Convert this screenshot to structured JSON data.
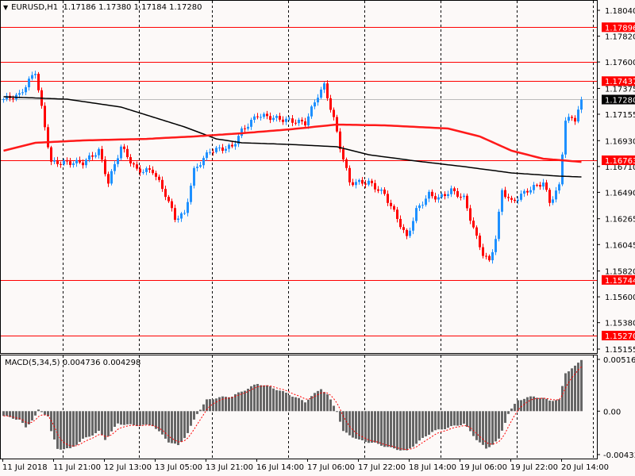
{
  "header": {
    "symbol": "EURUSD,H1",
    "ohlc": "1.17186 1.17380 1.17184 1.17280"
  },
  "macd": {
    "label": "MACD(5,34,5) 0.004736 0.004298"
  },
  "colors": {
    "background": "#fcf9f8",
    "bull": "#1e90ff",
    "bear": "#ff0000",
    "level_line": "#ff0000",
    "ma_slow": "#ff1a1a",
    "ma_fast": "#000000",
    "histogram": "#666666",
    "signal": "#ff0000"
  },
  "chart_data": {
    "type": "candlestick",
    "symbol": "EURUSD",
    "timeframe": "H1",
    "price_axis": {
      "range": [
        1.15155,
        1.1804
      ],
      "ticks": [
        "1.18040",
        "1.17820",
        "1.17600",
        "1.17375",
        "1.17155",
        "1.16930",
        "1.16710",
        "1.16490",
        "1.16265",
        "1.16045",
        "1.15820",
        "1.15600",
        "1.15380",
        "1.15155"
      ]
    },
    "levels": [
      {
        "price": "1.17896",
        "labeled": true
      },
      {
        "price": "1.17600",
        "labeled": false
      },
      {
        "price": "1.17437",
        "labeled": true
      },
      {
        "price": "1.16763",
        "labeled": true
      },
      {
        "price": "1.15744",
        "labeled": true
      },
      {
        "price": "1.15270",
        "labeled": true
      }
    ],
    "current_price": "1.17280",
    "time_labels": [
      "11 Jul 2018",
      "11 Jul 21:00",
      "12 Jul 13:00",
      "13 Jul 05:00",
      "13 Jul 21:00",
      "16 Jul 14:00",
      "17 Jul 06:00",
      "17 Jul 22:00",
      "18 Jul 14:00",
      "19 Jul 06:00",
      "19 Jul 22:00",
      "20 Jul 14:00"
    ],
    "bars_total": 183,
    "close_keypoints": [
      [
        0,
        1.17283
      ],
      [
        5,
        1.17317
      ],
      [
        10,
        1.1752
      ],
      [
        13,
        1.17047
      ],
      [
        15,
        1.16743
      ],
      [
        20,
        1.16743
      ],
      [
        25,
        1.16743
      ],
      [
        30,
        1.16844
      ],
      [
        33,
        1.16574
      ],
      [
        37,
        1.16878
      ],
      [
        42,
        1.16675
      ],
      [
        47,
        1.16675
      ],
      [
        51,
        1.16472
      ],
      [
        54,
        1.1627
      ],
      [
        57,
        1.16304
      ],
      [
        60,
        1.16675
      ],
      [
        65,
        1.16844
      ],
      [
        72,
        1.16878
      ],
      [
        75,
        1.17013
      ],
      [
        80,
        1.17148
      ],
      [
        87,
        1.17114
      ],
      [
        95,
        1.17081
      ],
      [
        99,
        1.17317
      ],
      [
        101,
        1.17398
      ],
      [
        104,
        1.17114
      ],
      [
        106,
        1.16878
      ],
      [
        109,
        1.16574
      ],
      [
        115,
        1.16574
      ],
      [
        120,
        1.16472
      ],
      [
        124,
        1.1627
      ],
      [
        127,
        1.16101
      ],
      [
        130,
        1.16337
      ],
      [
        134,
        1.16472
      ],
      [
        137,
        1.16439
      ],
      [
        141,
        1.16506
      ],
      [
        145,
        1.16439
      ],
      [
        149,
        1.16101
      ],
      [
        151,
        1.15966
      ],
      [
        153,
        1.15898
      ],
      [
        155,
        1.16101
      ],
      [
        157,
        1.16506
      ],
      [
        160,
        1.16405
      ],
      [
        165,
        1.16506
      ],
      [
        170,
        1.16574
      ],
      [
        172,
        1.16405
      ],
      [
        175,
        1.1654
      ],
      [
        177,
        1.17114
      ],
      [
        180,
        1.17114
      ],
      [
        182,
        1.17283
      ]
    ],
    "ma_fast_keypoints": [
      [
        0,
        1.17304
      ],
      [
        20,
        1.17283
      ],
      [
        37,
        1.17216
      ],
      [
        57,
        1.17047
      ],
      [
        67,
        1.16945
      ],
      [
        75,
        1.16912
      ],
      [
        90,
        1.16898
      ],
      [
        105,
        1.16878
      ],
      [
        115,
        1.1681
      ],
      [
        130,
        1.16756
      ],
      [
        145,
        1.16709
      ],
      [
        160,
        1.16655
      ],
      [
        175,
        1.16628
      ],
      [
        182,
        1.16621
      ]
    ],
    "ma_slow_keypoints": [
      [
        0,
        1.16844
      ],
      [
        10,
        1.16912
      ],
      [
        25,
        1.16932
      ],
      [
        45,
        1.16945
      ],
      [
        60,
        1.16966
      ],
      [
        75,
        1.16993
      ],
      [
        90,
        1.17026
      ],
      [
        105,
        1.17067
      ],
      [
        120,
        1.1706
      ],
      [
        140,
        1.17033
      ],
      [
        150,
        1.16966
      ],
      [
        160,
        1.16844
      ],
      [
        170,
        1.16776
      ],
      [
        182,
        1.16749
      ]
    ],
    "macd_axis": {
      "ticks": [
        "0.005168",
        "0.00",
        "-0.004333"
      ],
      "range": [
        -0.004333,
        0.005168
      ]
    },
    "macd_hist_keypoints": [
      [
        0,
        -0.00047
      ],
      [
        5,
        -0.00086
      ],
      [
        7,
        -0.00164
      ],
      [
        10,
        -0.00047
      ],
      [
        11,
        8e-05
      ],
      [
        14,
        -0.00047
      ],
      [
        15,
        -0.00204
      ],
      [
        17,
        -0.00376
      ],
      [
        21,
        -0.00376
      ],
      [
        25,
        -0.00282
      ],
      [
        30,
        -0.00204
      ],
      [
        32,
        -0.00282
      ],
      [
        36,
        -0.00125
      ],
      [
        41,
        -0.00141
      ],
      [
        47,
        -0.00141
      ],
      [
        52,
        -0.00305
      ],
      [
        55,
        -0.00344
      ],
      [
        58,
        -0.00219
      ],
      [
        61,
        -0.00023
      ],
      [
        64,
        0.0011
      ],
      [
        67,
        0.00133
      ],
      [
        72,
        0.00149
      ],
      [
        75,
        0.00196
      ],
      [
        80,
        0.00274
      ],
      [
        84,
        0.00243
      ],
      [
        89,
        0.0018
      ],
      [
        95,
        0.00094
      ],
      [
        100,
        0.00227
      ],
      [
        102,
        0.00164
      ],
      [
        105,
        0.0
      ],
      [
        107,
        -0.00204
      ],
      [
        112,
        -0.0029
      ],
      [
        117,
        -0.00321
      ],
      [
        122,
        -0.00368
      ],
      [
        127,
        -0.00399
      ],
      [
        130,
        -0.00321
      ],
      [
        135,
        -0.00204
      ],
      [
        140,
        -0.00164
      ],
      [
        145,
        -0.00125
      ],
      [
        149,
        -0.00282
      ],
      [
        152,
        -0.00376
      ],
      [
        156,
        -0.00282
      ],
      [
        159,
        -0.00023
      ],
      [
        162,
        0.0011
      ],
      [
        167,
        0.00149
      ],
      [
        172,
        0.0011
      ],
      [
        175,
        0.0011
      ],
      [
        177,
        0.00384
      ],
      [
        180,
        0.00446
      ],
      [
        182,
        0.00517
      ]
    ]
  }
}
